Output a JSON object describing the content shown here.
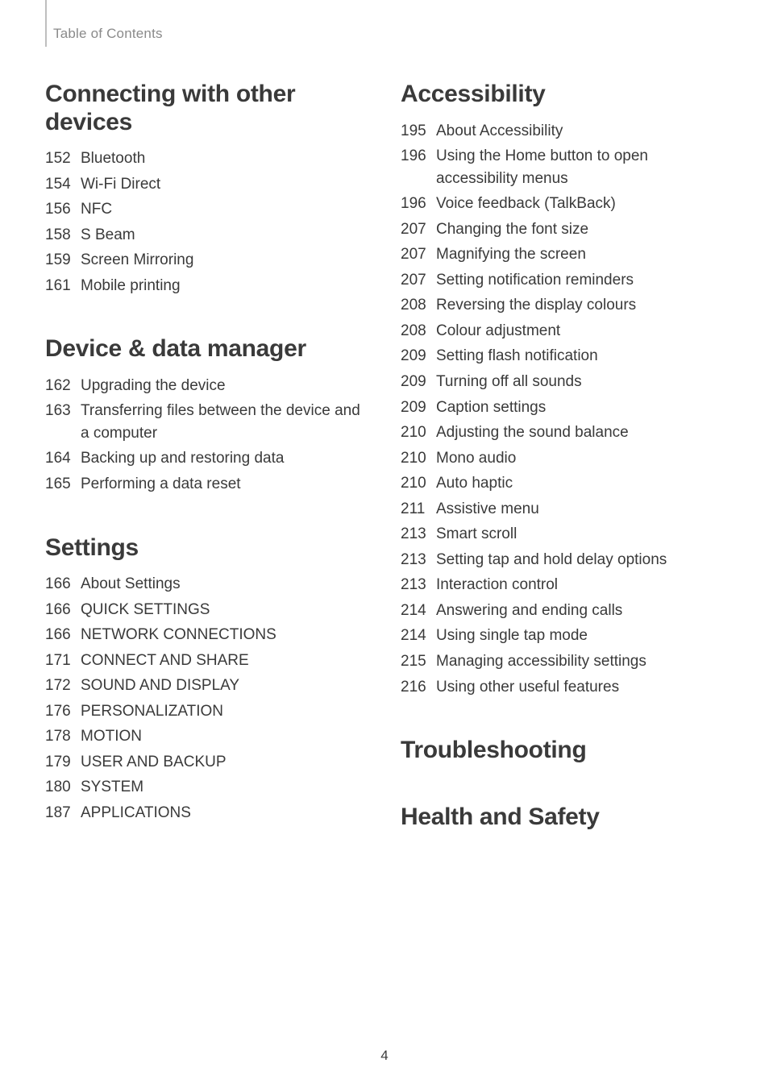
{
  "breadcrumb": "Table of Contents",
  "page_number": "4",
  "sections_left": [
    {
      "heading": "Connecting with other devices",
      "items": [
        {
          "page": "152",
          "title": "Bluetooth"
        },
        {
          "page": "154",
          "title": "Wi-Fi Direct"
        },
        {
          "page": "156",
          "title": "NFC"
        },
        {
          "page": "158",
          "title": "S Beam"
        },
        {
          "page": "159",
          "title": "Screen Mirroring"
        },
        {
          "page": "161",
          "title": "Mobile printing"
        }
      ]
    },
    {
      "heading": "Device & data manager",
      "items": [
        {
          "page": "162",
          "title": "Upgrading the device"
        },
        {
          "page": "163",
          "title": "Transferring files between the device and a computer"
        },
        {
          "page": "164",
          "title": "Backing up and restoring data"
        },
        {
          "page": "165",
          "title": "Performing a data reset"
        }
      ]
    },
    {
      "heading": "Settings",
      "items": [
        {
          "page": "166",
          "title": "About Settings"
        },
        {
          "page": "166",
          "title": "QUICK SETTINGS"
        },
        {
          "page": "166",
          "title": "NETWORK CONNECTIONS"
        },
        {
          "page": "171",
          "title": "CONNECT AND SHARE"
        },
        {
          "page": "172",
          "title": "SOUND AND DISPLAY"
        },
        {
          "page": "176",
          "title": "PERSONALIZATION"
        },
        {
          "page": "178",
          "title": "MOTION"
        },
        {
          "page": "179",
          "title": "USER AND BACKUP"
        },
        {
          "page": "180",
          "title": "SYSTEM"
        },
        {
          "page": "187",
          "title": "APPLICATIONS"
        }
      ]
    }
  ],
  "sections_right": [
    {
      "heading": "Accessibility",
      "items": [
        {
          "page": "195",
          "title": "About Accessibility"
        },
        {
          "page": "196",
          "title": "Using the Home button to open accessibility menus"
        },
        {
          "page": "196",
          "title": "Voice feedback (TalkBack)"
        },
        {
          "page": "207",
          "title": "Changing the font size"
        },
        {
          "page": "207",
          "title": "Magnifying the screen"
        },
        {
          "page": "207",
          "title": "Setting notification reminders"
        },
        {
          "page": "208",
          "title": "Reversing the display colours"
        },
        {
          "page": "208",
          "title": "Colour adjustment"
        },
        {
          "page": "209",
          "title": "Setting flash notification"
        },
        {
          "page": "209",
          "title": "Turning off all sounds"
        },
        {
          "page": "209",
          "title": "Caption settings"
        },
        {
          "page": "210",
          "title": "Adjusting the sound balance"
        },
        {
          "page": "210",
          "title": "Mono audio"
        },
        {
          "page": "210",
          "title": "Auto haptic"
        },
        {
          "page": "211",
          "title": "Assistive menu"
        },
        {
          "page": "213",
          "title": "Smart scroll"
        },
        {
          "page": "213",
          "title": "Setting tap and hold delay options"
        },
        {
          "page": "213",
          "title": "Interaction control"
        },
        {
          "page": "214",
          "title": "Answering and ending calls"
        },
        {
          "page": "214",
          "title": "Using single tap mode"
        },
        {
          "page": "215",
          "title": "Managing accessibility settings"
        },
        {
          "page": "216",
          "title": "Using other useful features"
        }
      ]
    },
    {
      "heading": "Troubleshooting",
      "items": []
    },
    {
      "heading": "Health and Safety",
      "items": []
    }
  ]
}
